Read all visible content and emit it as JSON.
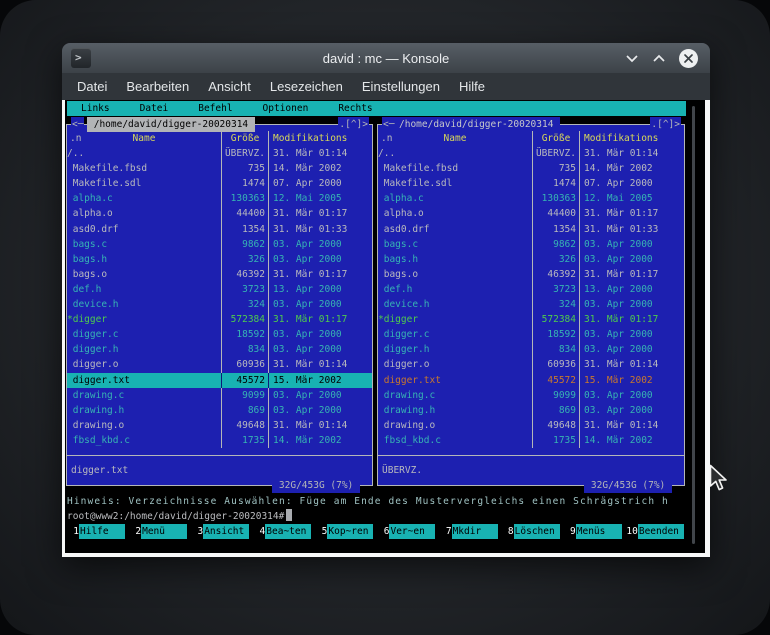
{
  "window": {
    "title": "david : mc — Konsole",
    "icon_glyph": ">"
  },
  "menubar": {
    "items": [
      "Datei",
      "Bearbeiten",
      "Ansicht",
      "Lesezeichen",
      "Einstellungen",
      "Hilfe"
    ]
  },
  "mc": {
    "menubar": [
      "Links",
      "Datei",
      "Befehl",
      "Optionen",
      "Rechts"
    ],
    "columns": {
      "sort": ".n",
      "name": "Name",
      "size": "Größe",
      "mtime": "Modifikations"
    },
    "panels": [
      {
        "side": "left",
        "active": true,
        "arrow": "<─",
        "path": " /home/david/digger-20020314 ",
        "corner": ".[^]>",
        "status": "digger.txt",
        "disk": " 32G/453G (7%) "
      },
      {
        "side": "right",
        "active": false,
        "arrow": "<─ ",
        "path": "/home/david/digger-20020314 ",
        "corner": ".[^]>",
        "status": "ÜBERVZ.",
        "disk": " 32G/453G (7%) "
      }
    ],
    "files": [
      {
        "display": "/..",
        "size": "ÜBERVZ.",
        "mtime": "31. Mär 01:14",
        "kind": "plain"
      },
      {
        "display": " Makefile.fbsd",
        "size": "735",
        "mtime": "14. Mär 2002",
        "kind": "plain"
      },
      {
        "display": " Makefile.sdl",
        "size": "1474",
        "mtime": "07. Apr 2000",
        "kind": "plain"
      },
      {
        "display": " alpha.c",
        "size": "130363",
        "mtime": "12. Mai 2005",
        "kind": "source"
      },
      {
        "display": " alpha.o",
        "size": "44400",
        "mtime": "31. Mär 01:17",
        "kind": "plain"
      },
      {
        "display": " asd0.drf",
        "size": "1354",
        "mtime": "31. Mär 01:33",
        "kind": "plain"
      },
      {
        "display": " bags.c",
        "size": "9862",
        "mtime": "03. Apr 2000",
        "kind": "source"
      },
      {
        "display": " bags.h",
        "size": "326",
        "mtime": "03. Apr 2000",
        "kind": "source"
      },
      {
        "display": " bags.o",
        "size": "46392",
        "mtime": "31. Mär 01:17",
        "kind": "plain"
      },
      {
        "display": " def.h",
        "size": "3723",
        "mtime": "13. Apr 2000",
        "kind": "source"
      },
      {
        "display": " device.h",
        "size": "324",
        "mtime": "03. Apr 2000",
        "kind": "source"
      },
      {
        "display": "*digger",
        "size": "572384",
        "mtime": "31. Mär 01:17",
        "kind": "exec"
      },
      {
        "display": " digger.c",
        "size": "18592",
        "mtime": "03. Apr 2000",
        "kind": "source"
      },
      {
        "display": " digger.h",
        "size": "834",
        "mtime": "03. Apr 2000",
        "kind": "source"
      },
      {
        "display": " digger.o",
        "size": "60936",
        "mtime": "31. Mär 01:14",
        "kind": "plain"
      },
      {
        "display": " digger.txt",
        "size": "45572",
        "mtime": "15. Mär 2002",
        "kind": "cursor"
      },
      {
        "display": " drawing.c",
        "size": "9099",
        "mtime": "03. Apr 2000",
        "kind": "source"
      },
      {
        "display": " drawing.h",
        "size": "869",
        "mtime": "03. Apr 2000",
        "kind": "source"
      },
      {
        "display": " drawing.o",
        "size": "49648",
        "mtime": "31. Mär 01:14",
        "kind": "plain"
      },
      {
        "display": " fbsd_kbd.c",
        "size": "1735",
        "mtime": "14. Mär 2002",
        "kind": "source"
      }
    ],
    "hint": "Hinweis: Verzeichnisse Auswählen: Füge am Ende des Mustervergleichs einen Schrägstrich h",
    "prompt": "root@www2:/home/david/digger-20020314#",
    "fnkeys": [
      {
        "num": "1",
        "label": "Hilfe"
      },
      {
        "num": "2",
        "label": "Menü"
      },
      {
        "num": "3",
        "label": "Ansicht"
      },
      {
        "num": "4",
        "label": "Bea~ten"
      },
      {
        "num": "5",
        "label": "Kop~ren"
      },
      {
        "num": "6",
        "label": "Ver~en"
      },
      {
        "num": "7",
        "label": "Mkdir"
      },
      {
        "num": "8",
        "label": "Löschen"
      },
      {
        "num": "9",
        "label": "Menüs"
      },
      {
        "num": "10",
        "label": "Beenden"
      }
    ]
  },
  "colors": {
    "panel_blue": "#1d20b0",
    "mc_cyan": "#18b2b2",
    "text_grey": "#b9babd",
    "text_cyan": "#37b3b3",
    "text_green": "#4ecb4e",
    "text_yellow": "#d8d85a",
    "cursor_inactive_orange": "#c8782d",
    "terminal_black": "#000000"
  }
}
